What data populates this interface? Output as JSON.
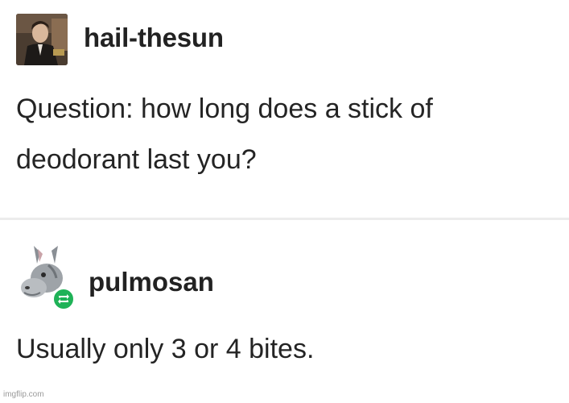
{
  "post1": {
    "username": "hail-thesun",
    "text_line1": "Question: how long does a stick of",
    "text_line2": "deodorant last you?"
  },
  "post2": {
    "username": "pulmosan",
    "text": "Usually only 3 or 4 bites."
  },
  "watermark": "imgflip.com",
  "colors": {
    "reblog_badge": "#1fb257",
    "divider": "#ececec",
    "text": "#242424"
  }
}
